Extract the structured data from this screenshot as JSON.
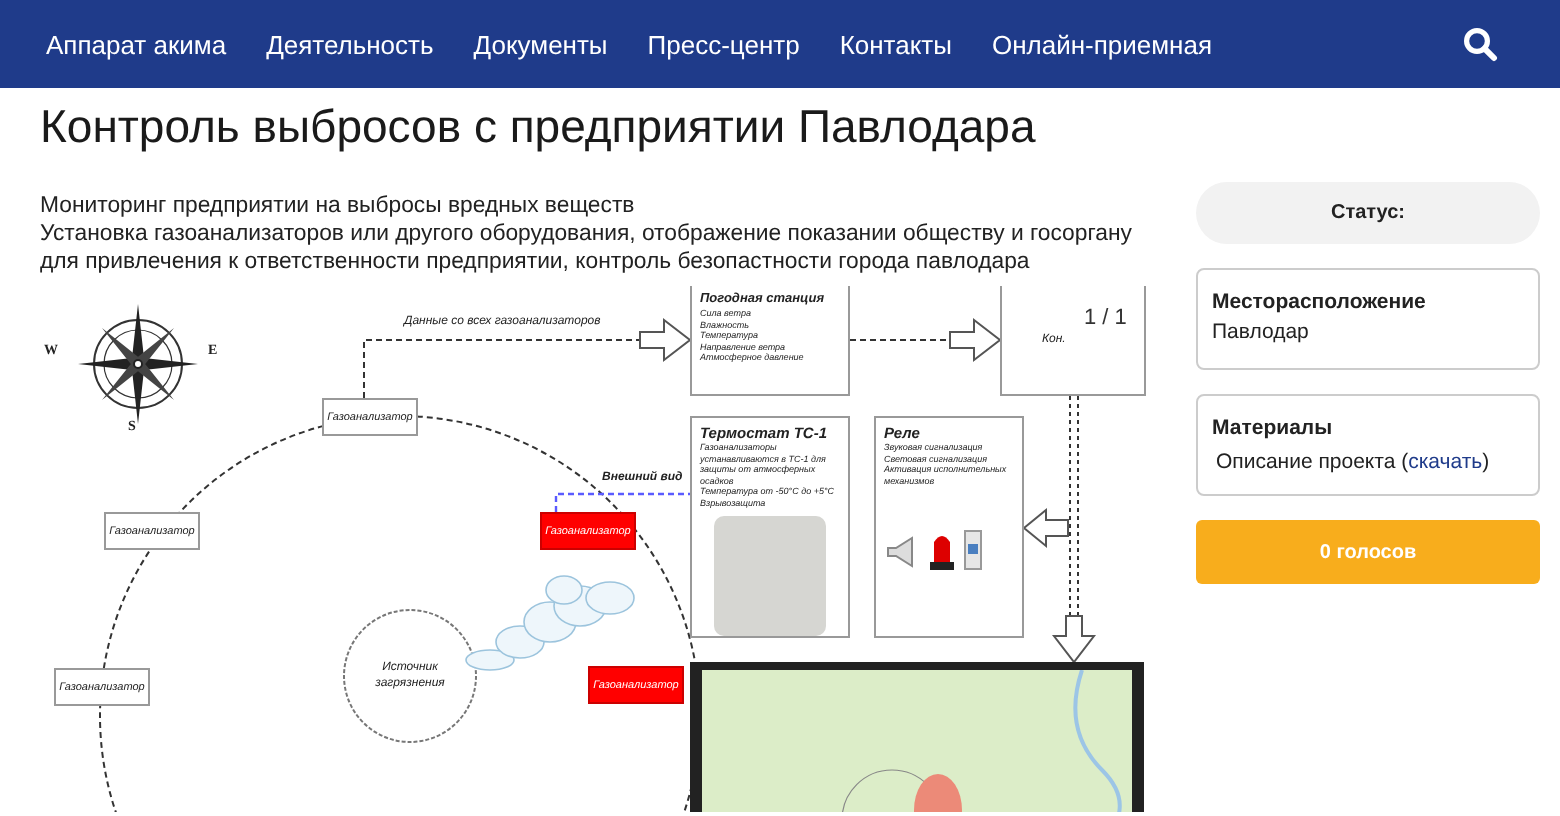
{
  "nav": {
    "items": [
      "Аппарат акима",
      "Деятельность",
      "Документы",
      "Пресс-центр",
      "Контакты",
      "Онлайн-приемная"
    ]
  },
  "title": "Контроль выбросов с предприятии Павлодара",
  "description": [
    "Мониторинг предприятии на выбросы вредных веществ",
    "Установка газоанализаторов или другого оборудования, отображение показании обществу и госоргану для привлечения к ответственности предприятии, контроль безопастности города павлодара"
  ],
  "diagram": {
    "compass_letters": [
      "W",
      "E",
      "S"
    ],
    "data_label": "Данные со всех газоанализаторов",
    "analyzers": [
      {
        "label": "Газоанализатор",
        "alert": false
      },
      {
        "label": "Газоанализатор",
        "alert": false
      },
      {
        "label": "Газоанализатор",
        "alert": false
      },
      {
        "label": "Газоанализатор",
        "alert": true
      },
      {
        "label": "Газоанализатор",
        "alert": true
      }
    ],
    "source": "Источник загрязнения",
    "weather": {
      "title": "Погодная станция",
      "items": [
        "Сила ветра",
        "Влажность",
        "Температура",
        "Направление ветра",
        "Атмосферное давление"
      ]
    },
    "controller": {
      "label": "Кон."
    },
    "slide_counter": "1 / 1",
    "external_view_label": "Внешний вид",
    "thermostat": {
      "title": "Термостат ТС-1",
      "items": [
        "Газоанализаторы устанавливаются в ТС-1 для защиты от атмосферных осадков",
        "Температура от -50°C до +5°C",
        "Взрывозащита"
      ]
    },
    "relay": {
      "title": "Реле",
      "items": [
        "Звуковая сигнализация",
        "Световая сигнализация",
        "Активация исполнительных механизмов"
      ]
    }
  },
  "sidebar": {
    "status_label": "Статус:",
    "location": {
      "title": "Месторасположение",
      "value": "Павлодар"
    },
    "materials": {
      "title": "Материалы",
      "text_before": "Описание проекта (",
      "link": "скачать",
      "text_after": ")"
    },
    "vote_button": "0 голосов"
  }
}
